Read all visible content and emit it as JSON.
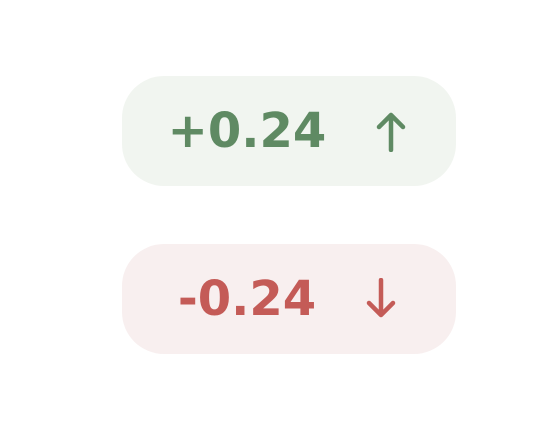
{
  "badges": {
    "increase": {
      "value": "+0.24",
      "icon": "arrow-up-icon",
      "color": "#5f8a63",
      "background": "#f1f5f0"
    },
    "decrease": {
      "value": "-0.24",
      "icon": "arrow-down-icon",
      "color": "#c45b57",
      "background": "#f8efef"
    }
  }
}
